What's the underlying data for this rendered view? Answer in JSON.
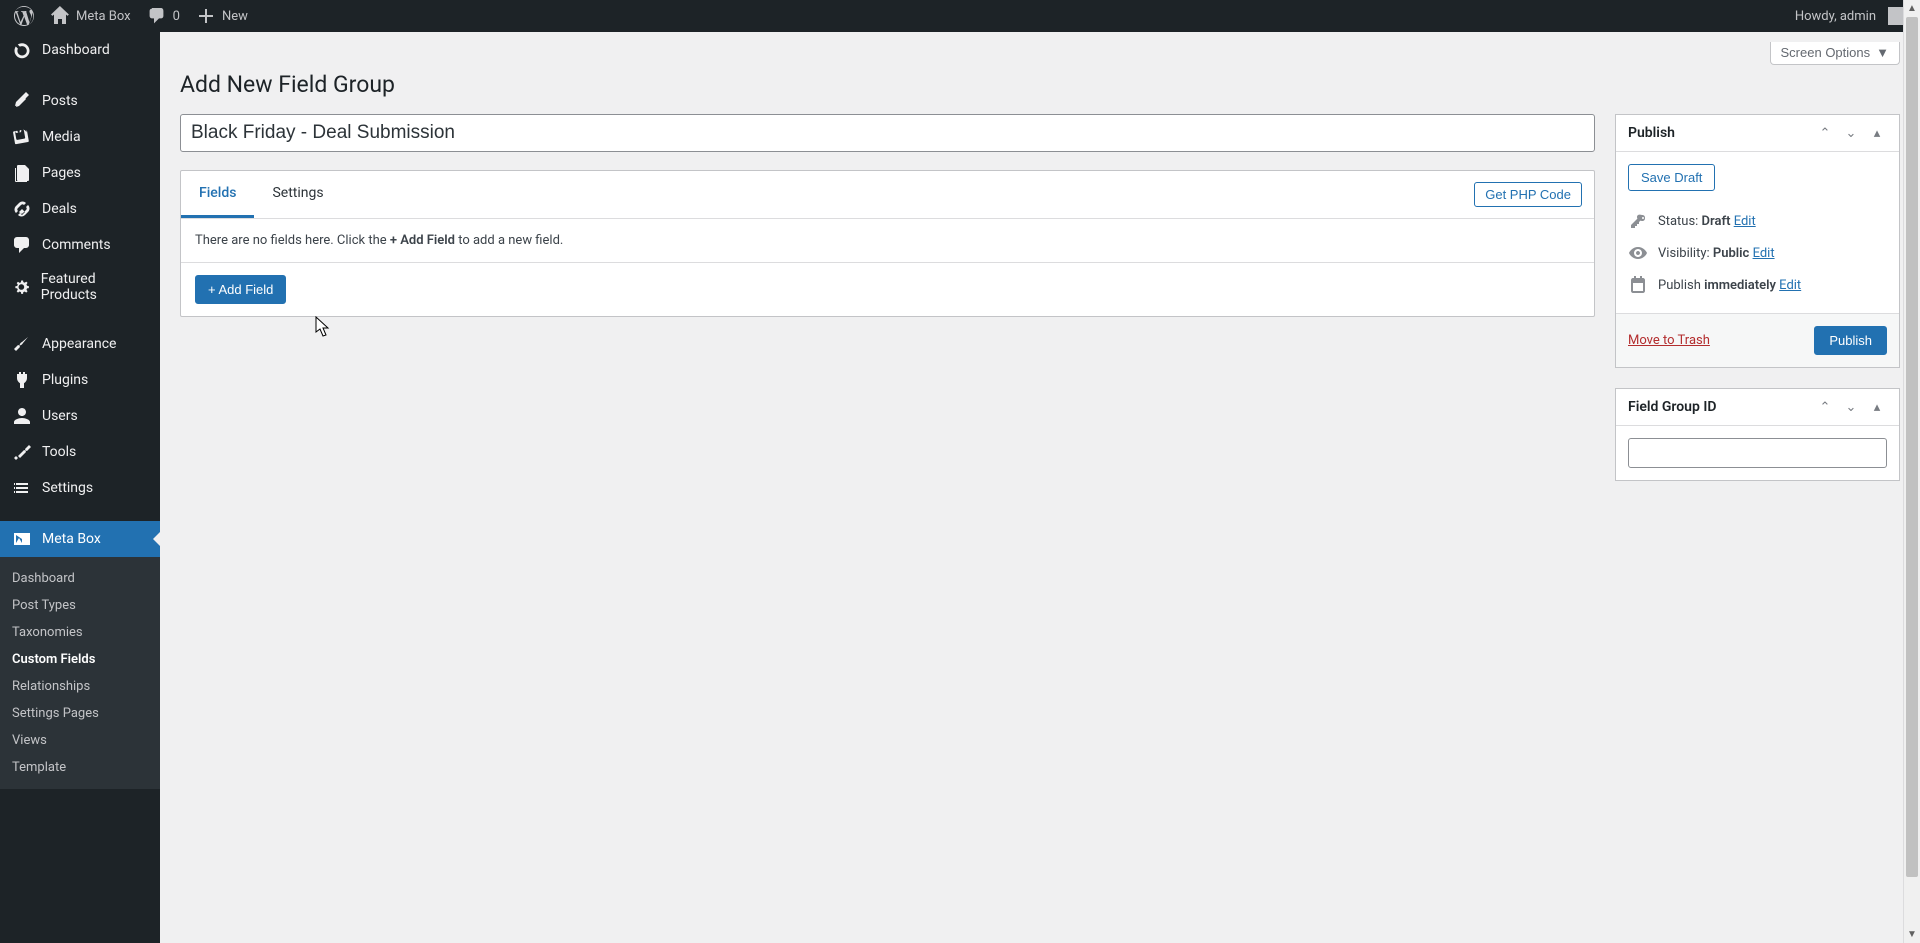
{
  "adminbar": {
    "site": "Meta Box",
    "comments": "0",
    "new": "New",
    "howdy": "Howdy, admin"
  },
  "sidebar": {
    "dashboard": "Dashboard",
    "posts": "Posts",
    "media": "Media",
    "pages": "Pages",
    "deals": "Deals",
    "comments": "Comments",
    "featured_products": "Featured Products",
    "appearance": "Appearance",
    "plugins": "Plugins",
    "users": "Users",
    "tools": "Tools",
    "settings": "Settings",
    "metabox": "Meta Box",
    "sub": {
      "dashboard": "Dashboard",
      "post_types": "Post Types",
      "taxonomies": "Taxonomies",
      "custom_fields": "Custom Fields",
      "relationships": "Relationships",
      "settings_pages": "Settings Pages",
      "views": "Views",
      "template": "Template"
    }
  },
  "screen_options": "Screen Options",
  "page_title": "Add New Field Group",
  "title_value": "Black Friday - Deal Submission",
  "tabs": {
    "fields": "Fields",
    "settings": "Settings"
  },
  "get_php": "Get PHP Code",
  "empty_pre": "There are no fields here. Click the ",
  "empty_bold": "+ Add Field",
  "empty_post": " to add a new field.",
  "add_field": "+ Add Field",
  "publish": {
    "title": "Publish",
    "save_draft": "Save Draft",
    "status_label": "Status: ",
    "status_value": "Draft",
    "visibility_label": "Visibility: ",
    "visibility_value": "Public",
    "publish_label": "Publish ",
    "publish_value": "immediately",
    "edit": "Edit",
    "trash": "Move to Trash",
    "publish_btn": "Publish"
  },
  "fg_id": {
    "title": "Field Group ID",
    "value": ""
  }
}
